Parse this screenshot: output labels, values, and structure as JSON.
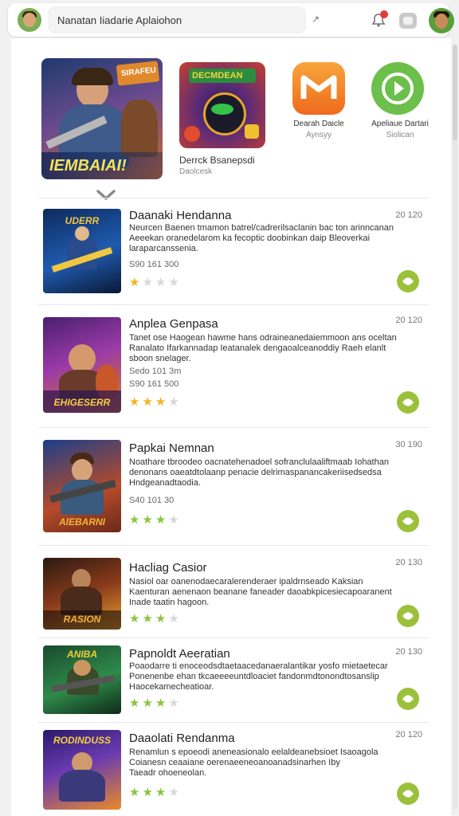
{
  "topbar": {
    "search_text": "Nanatan Iiadarie Aplaiohon",
    "dropdown_glyph": "↗",
    "icons": [
      "avatar-icon",
      "search-dropdown-icon",
      "notification-icon",
      "window-icon",
      "profile-avatar"
    ]
  },
  "featured": [
    {
      "banner_text": "IEMBAIAI!",
      "badge_text": "SIRAFEU",
      "title": "",
      "subtitle": ""
    },
    {
      "banner_text": "DECMDEAN",
      "title": "Derrck Bsanepsdi",
      "subtitle": "Daolcesk"
    },
    {
      "icon": "orange-m-logo",
      "title": "Dearah Daicle",
      "subtitle": "Aynsyy"
    },
    {
      "icon": "green-play-logo",
      "title": "Apeliaue Dartari",
      "subtitle": "Siolican"
    }
  ],
  "apps": [
    {
      "thumb_label": "UDERR",
      "title": "Daanaki Hendanna",
      "size": "20 120",
      "desc": [
        "Neurcen Baenen tmamon batrel/cadrerilsaclanin bac ton arinncanan",
        "Aeeekan oranedelarom ka fecoptic doobinkan daip Bleoverkai",
        "laraparcanssenia."
      ],
      "meta": "S90 161 300",
      "rating": 1
    },
    {
      "thumb_label": "EHIGESERR",
      "title": "Anplea Genpasa",
      "size": "20 120",
      "desc": [
        "Tanet ose Haogean hawme hans odraineanedaiemmoon ans oceltan",
        "Ranalato Ifarkannadap Ieatanalek dengaoalceanoddiy Raeh elanlt",
        "sboon snelager."
      ],
      "meta": "Sedo 101 3m",
      "meta2": "S90 161 500",
      "rating": 3
    },
    {
      "thumb_label": "AlEBARNI",
      "title": "Papkai Nemnan",
      "size": "30 190",
      "desc": [
        "Noathare tbroodeo oacnatehenadoel sofranclulaaliftmaab Iohathan",
        "denonans oaeatdtolaanp penacie delrimaspanancakeriisedsedsa",
        "Hndgeanadtaodia."
      ],
      "meta": "S40 101 30",
      "rating": 3
    },
    {
      "thumb_label": "RASION",
      "title": "Hacliag Casior",
      "size": "20 130",
      "desc": [
        "Nasiol oar oanenodaecaralerenderaer ipaldrnseado Kaksian",
        "Kaenturan aenenaon beanane faneader daoabkpicesiecapoaranent",
        "Inade taatin hagoon."
      ],
      "rating": 3
    },
    {
      "thumb_label": "ANIBA",
      "title": "Papnoldt Aeeratian",
      "size": "20 130",
      "desc": [
        "Poaodarre ti enoceodsdtaetaacedanaeralantikar yosfo mietaetecar",
        "Ponenenbe ehan tkcaeeeeuntdloaciet fandonmdtonondtosanslip",
        "Haocekamecheatioar."
      ],
      "rating": 3
    },
    {
      "thumb_label": "RODINDUSS",
      "title": "Daaolati Rendanma",
      "size": "20 120",
      "desc": [
        "Renamlun s epoeodi aneneasionalo eelaldeanebsioet Isaoagola",
        "Coianesn ceaaiane oerenaeeneoanoanadsinarhen Iby",
        "Taeadr ohoeneolan."
      ],
      "rating": 3
    }
  ],
  "colors": {
    "accent_green": "#9bc13b",
    "star_gold": "#f2b51c",
    "star_green": "#8ac53f",
    "star_empty": "#d7d7d7",
    "badge_red": "#e53935"
  }
}
